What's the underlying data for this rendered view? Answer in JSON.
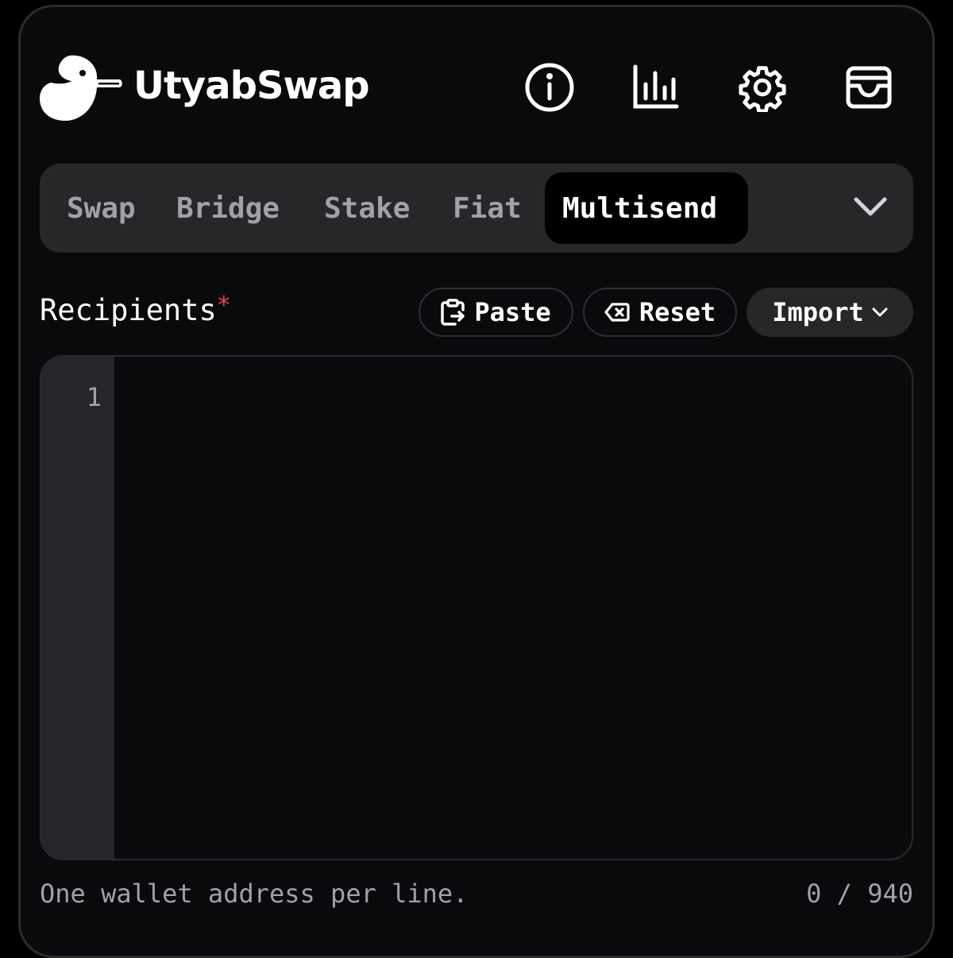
{
  "header": {
    "brand": "UtyabSwap",
    "icons": [
      "duck-logo-icon",
      "info-icon",
      "stats-icon",
      "gear-icon",
      "wallet-icon"
    ]
  },
  "tabs": [
    {
      "label": "Swap",
      "active": false
    },
    {
      "label": "Bridge",
      "active": false
    },
    {
      "label": "Stake",
      "active": false
    },
    {
      "label": "Fiat",
      "active": false
    },
    {
      "label": "Multisend",
      "active": true
    }
  ],
  "recipients": {
    "label": "Recipients",
    "required_mark": "*",
    "paste_label": "Paste",
    "reset_label": "Reset",
    "import_label": "Import",
    "line_number": "1",
    "value": "",
    "hint": "One wallet address per line.",
    "counter": "0 / 940"
  },
  "colors": {
    "background": "#0a0a0c",
    "tab_bar": "#27272a",
    "muted_text": "#a1a1a8",
    "required": "#e5484d"
  }
}
